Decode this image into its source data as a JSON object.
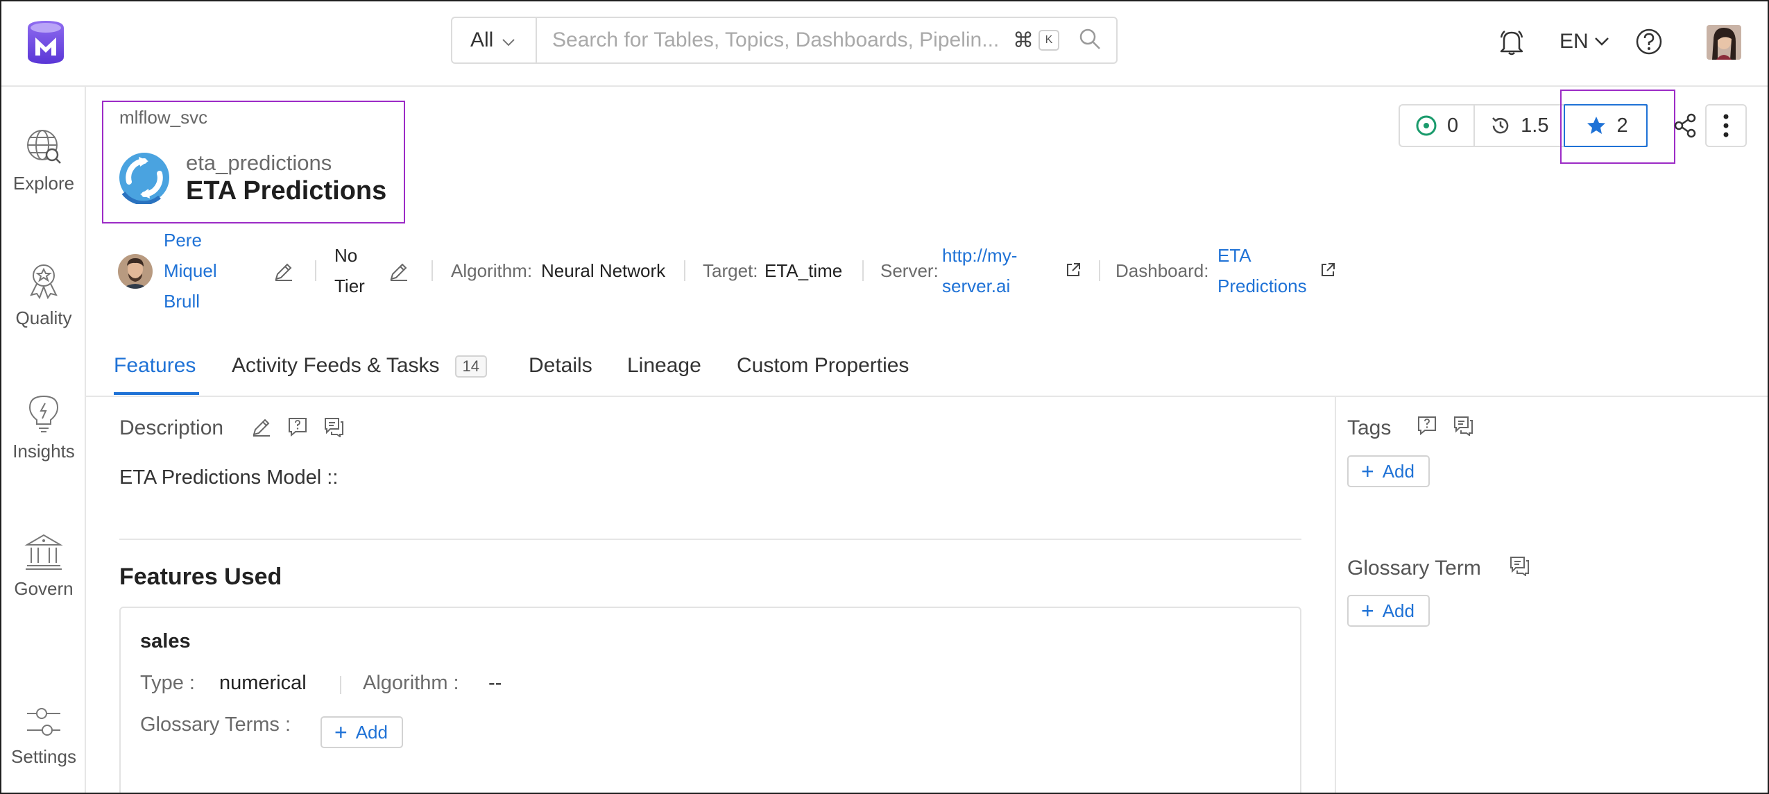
{
  "search": {
    "scope": "All",
    "placeholder": "Search for Tables, Topics, Dashboards, Pipelin...",
    "shortcut_key": "K",
    "shortcut_modifier": "⌘"
  },
  "header": {
    "language": "EN"
  },
  "nav": {
    "items": [
      {
        "label": "Explore"
      },
      {
        "label": "Quality"
      },
      {
        "label": "Insights"
      },
      {
        "label": "Govern"
      },
      {
        "label": "Settings"
      }
    ]
  },
  "entity": {
    "service": "mlflow_svc",
    "name": "eta_predictions",
    "display_name": "ETA Predictions"
  },
  "actions": {
    "followers": "0",
    "version": "1.5",
    "stars": "2"
  },
  "meta": {
    "owner_line1": "Pere",
    "owner_line2": "Miquel",
    "owner_line3": "Brull",
    "tier_line1": "No",
    "tier_line2": "Tier",
    "algorithm_label": "Algorithm:",
    "algorithm_value": "Neural Network",
    "target_label": "Target:",
    "target_value": "ETA_time",
    "server_label": "Server:",
    "server_line1": "http://my-",
    "server_line2": "server.ai",
    "dashboard_label": "Dashboard:",
    "dashboard_line1": "ETA",
    "dashboard_line2": "Predictions"
  },
  "tabs": [
    {
      "label": "Features",
      "active": true
    },
    {
      "label": "Activity Feeds & Tasks",
      "count": "14"
    },
    {
      "label": "Details"
    },
    {
      "label": "Lineage"
    },
    {
      "label": "Custom Properties"
    }
  ],
  "description": {
    "title": "Description",
    "text": "ETA Predictions Model ::"
  },
  "features": {
    "title": "Features Used",
    "items": [
      {
        "name": "sales",
        "type_label": "Type :",
        "type_value": "numerical",
        "algorithm_label": "Algorithm :",
        "algorithm_value": "--",
        "glossary_label": "Glossary Terms :",
        "add_label": "Add"
      }
    ]
  },
  "sidebar": {
    "tags_title": "Tags",
    "tags_add": "Add",
    "glossary_title": "Glossary Term",
    "glossary_add": "Add"
  },
  "colors": {
    "accent": "#1f72d6",
    "highlight": "#9c2bc6",
    "brand": "#7147e8"
  }
}
